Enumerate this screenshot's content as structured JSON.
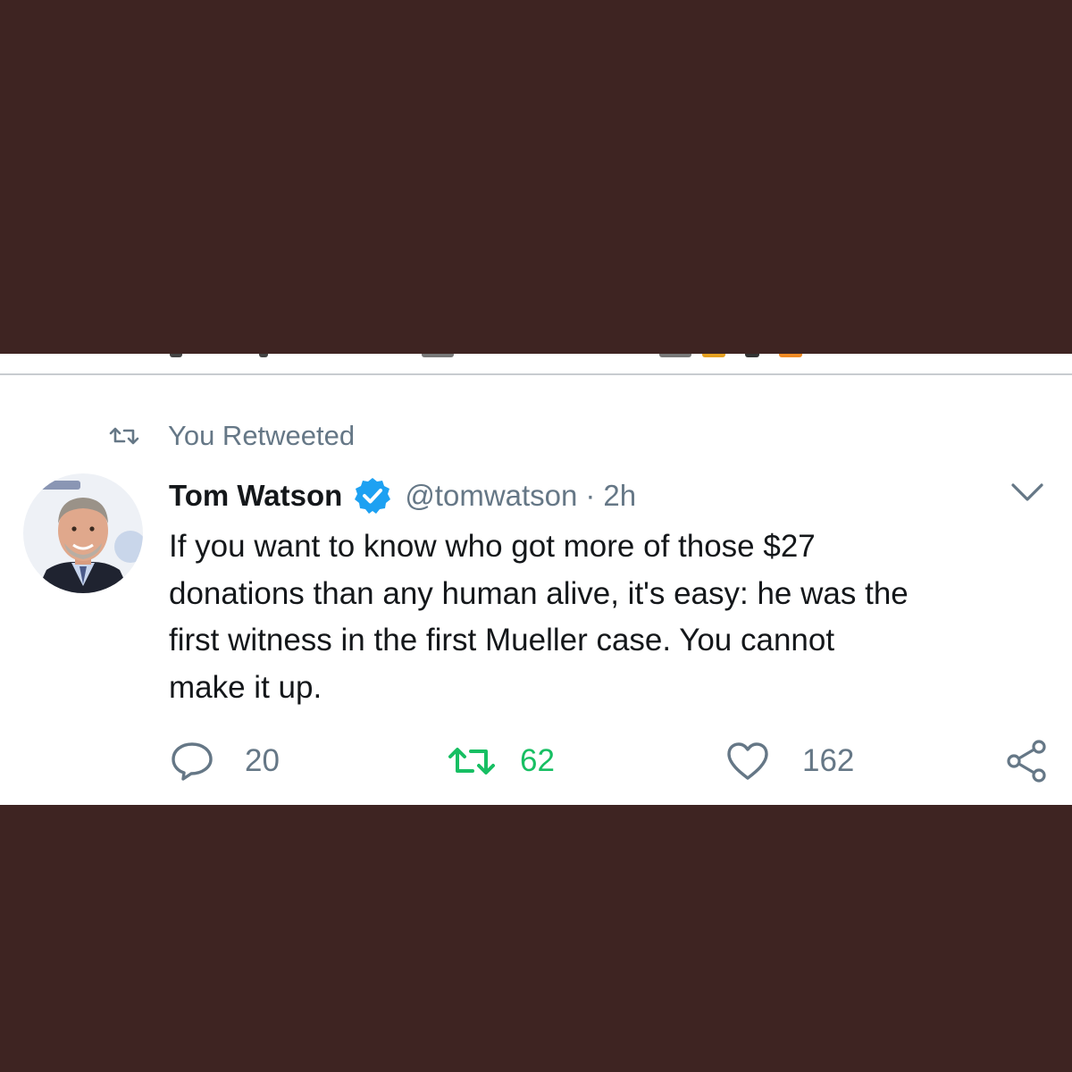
{
  "colors": {
    "background": "#3e2422",
    "card": "#ffffff",
    "text_primary": "#14171a",
    "text_secondary": "#657786",
    "retweet_active": "#17bf63",
    "verified_blue": "#1da1f2"
  },
  "retweet_banner": {
    "icon": "retweet-icon",
    "label": "You Retweeted"
  },
  "tweet": {
    "avatar": "avatar",
    "author": {
      "name": "Tom Watson",
      "verified_icon": "verified-badge-icon",
      "handle": "@tomwatson",
      "separator": "·",
      "time": "2h"
    },
    "menu_icon": "chevron-down-icon",
    "text_lines": [
      "If you want to know who got more of those $27",
      "donations than any human alive, it's easy: he was the",
      "first witness in the first Mueller case. You cannot",
      "make it up."
    ],
    "actions": {
      "reply": {
        "icon": "reply-icon",
        "count": "20"
      },
      "retweet": {
        "icon": "retweet-icon",
        "count": "62",
        "active": true
      },
      "like": {
        "icon": "heart-icon",
        "count": "162"
      },
      "share": {
        "icon": "share-icon"
      }
    }
  }
}
